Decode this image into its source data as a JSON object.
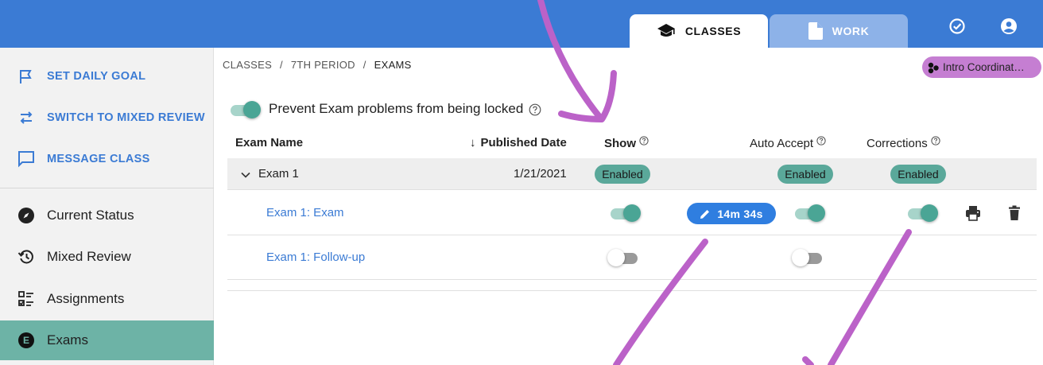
{
  "header": {
    "tabs": [
      {
        "label": "CLASSES",
        "icon": "graduation-cap-icon",
        "active": true
      },
      {
        "label": "WORK",
        "icon": "document-icon",
        "active": false
      }
    ],
    "icons": [
      "check-circle-icon",
      "account-icon"
    ],
    "colors": {
      "bar": "#3b7bd4",
      "inactive_tab": "#8db2e8"
    }
  },
  "sidebar": {
    "actions": [
      {
        "label": "SET DAILY GOAL",
        "icon": "flag-icon"
      },
      {
        "label": "SWITCH TO MIXED REVIEW",
        "icon": "swap-icon"
      },
      {
        "label": "MESSAGE CLASS",
        "icon": "message-icon"
      }
    ],
    "items": [
      {
        "label": "Current Status",
        "icon": "compass-icon",
        "active": false
      },
      {
        "label": "Mixed Review",
        "icon": "history-icon",
        "active": false
      },
      {
        "label": "Assignments",
        "icon": "checklist-icon",
        "active": false
      },
      {
        "label": "Exams",
        "icon": "exam-icon",
        "active": true
      }
    ],
    "colors": {
      "active": "#6db3a6",
      "action_text": "#3b7bd4"
    }
  },
  "breadcrumb": {
    "items": [
      "CLASSES",
      "7TH PERIOD",
      "EXAMS"
    ],
    "separator": "/"
  },
  "chip": {
    "label": "Intro Coordinat…",
    "color": "#c57ed2"
  },
  "lock_setting": {
    "label": "Prevent Exam problems from being locked",
    "enabled": true
  },
  "table": {
    "columns": {
      "name": "Exam Name",
      "date": "Published Date",
      "show": "Show",
      "auto_accept": "Auto Accept",
      "corrections": "Corrections"
    },
    "sort_indicator": "↓",
    "group": {
      "name": "Exam 1",
      "date": "1/21/2021",
      "show": "Enabled",
      "auto_accept": "Enabled",
      "corrections": "Enabled"
    },
    "rows": [
      {
        "name": "Exam 1: Exam",
        "show": true,
        "timer": "14m 34s",
        "auto_accept": true,
        "corrections": true
      },
      {
        "name": "Exam 1: Follow-up",
        "show": false,
        "auto_accept": false
      }
    ],
    "colors": {
      "badge": "#5aa89a",
      "toggle_on": "#4aa595",
      "timer": "#2f7ee0"
    }
  }
}
